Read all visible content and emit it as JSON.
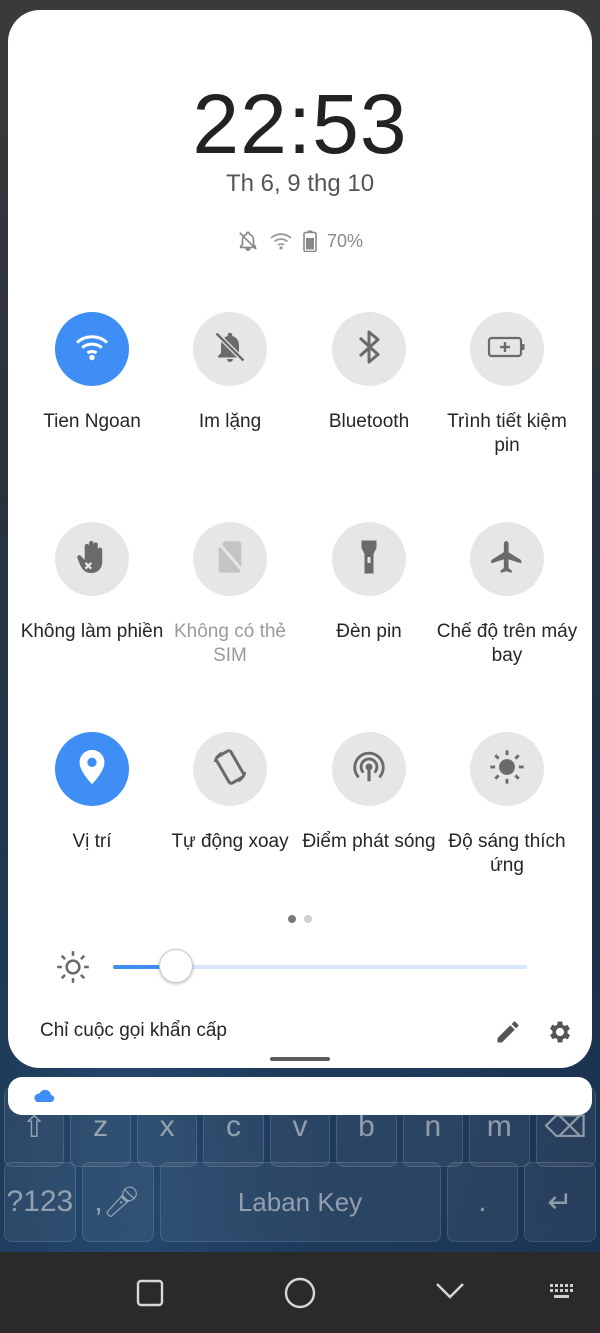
{
  "clock": {
    "time": "22:53",
    "date": "Th 6, 9 thg 10"
  },
  "status": {
    "battery_percent": "70%",
    "icons": [
      "bell-off-icon",
      "wifi-icon",
      "battery-icon"
    ]
  },
  "tiles": [
    {
      "label": "Tien Ngoan",
      "icon": "wifi-icon",
      "active": true
    },
    {
      "label": "Im lặng",
      "icon": "bell-off-icon",
      "active": false
    },
    {
      "label": "Bluetooth",
      "icon": "bluetooth-icon",
      "active": false
    },
    {
      "label": "Trình tiết kiệm pin",
      "icon": "battery-saver-icon",
      "active": false
    },
    {
      "label": "Không làm phiền",
      "icon": "hand-icon",
      "active": false
    },
    {
      "label": "Không có thẻ SIM",
      "icon": "sim-off-icon",
      "active": false,
      "disabled": true
    },
    {
      "label": "Đèn pin",
      "icon": "flashlight-icon",
      "active": false
    },
    {
      "label": "Chế độ trên máy bay",
      "icon": "airplane-icon",
      "active": false
    },
    {
      "label": "Vị trí",
      "icon": "location-icon",
      "active": true
    },
    {
      "label": "Tự động xoay",
      "icon": "rotate-icon",
      "active": false
    },
    {
      "label": "Điểm phát sóng",
      "icon": "hotspot-icon",
      "active": false
    },
    {
      "label": "Độ sáng thích ứng",
      "icon": "brightness-auto-icon",
      "active": false
    }
  ],
  "pager": {
    "pages": 2,
    "current": 1
  },
  "brightness": {
    "level": 0.15
  },
  "footer": {
    "emergency_text": "Chỉ cuộc gọi khẩn cấp"
  },
  "keyboard": {
    "row1": [
      "",
      "z",
      "x",
      "c",
      "v",
      "b",
      "n",
      "m",
      ""
    ],
    "row2": [
      "?123",
      ",",
      "Laban Key",
      ""
    ]
  },
  "colors": {
    "accent": "#3f8ef5",
    "tile_off": "#e6e6e6",
    "panel": "#ffffff"
  }
}
